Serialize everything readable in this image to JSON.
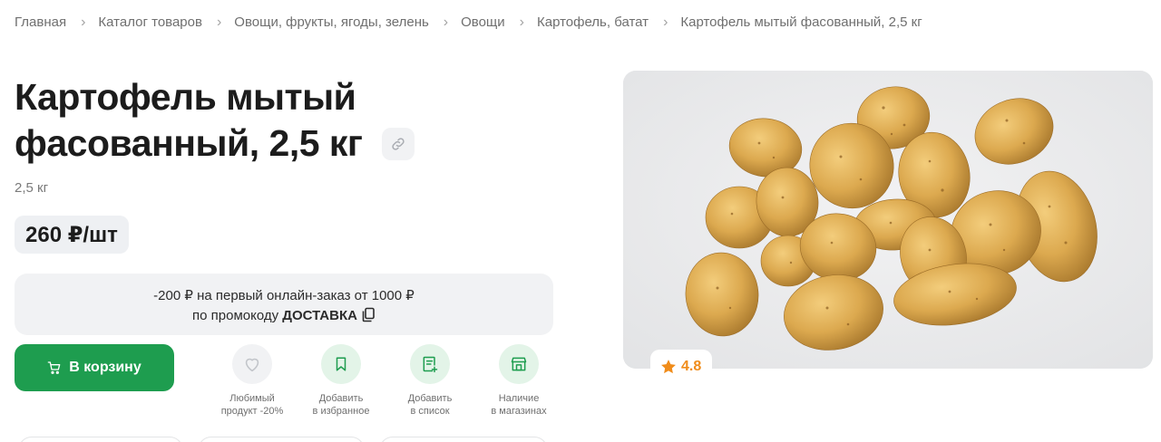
{
  "breadcrumbs": [
    "Главная",
    "Каталог товаров",
    "Овощи, фрукты, ягоды, зелень",
    "Овощи",
    "Картофель, батат",
    "Картофель мытый фасованный, 2,5 кг"
  ],
  "product": {
    "title_line1": "Картофель мытый",
    "title_line2": "фасованный, 2,5 кг",
    "weight": "2,5 кг",
    "price": "260 ₽/шт",
    "rating": "4.8"
  },
  "promo": {
    "line1": "-200 ₽ на первый онлайн-заказ от 1000 ₽",
    "line2_prefix": "по промокоду",
    "code": "ДОСТАВКА"
  },
  "actions": {
    "cart_label": "В корзину",
    "favorite_line1": "Любимый",
    "favorite_line2": "продукт -20%",
    "wishlist_line1": "Добавить",
    "wishlist_line2": "в избранное",
    "list_line1": "Добавить",
    "list_line2": "в список",
    "stores_line1": "Наличие",
    "stores_line2": "в магазинах"
  },
  "colors": {
    "accent_green": "#1e9d4f",
    "light_green": "#e3f4e8",
    "rating_orange": "#f08c1a",
    "surface_grey": "#f1f2f4"
  },
  "icons": [
    "chevron-right-icon",
    "link-icon",
    "copy-icon",
    "cart-icon",
    "heart-icon",
    "bookmark-icon",
    "list-add-icon",
    "store-icon",
    "star-icon"
  ]
}
